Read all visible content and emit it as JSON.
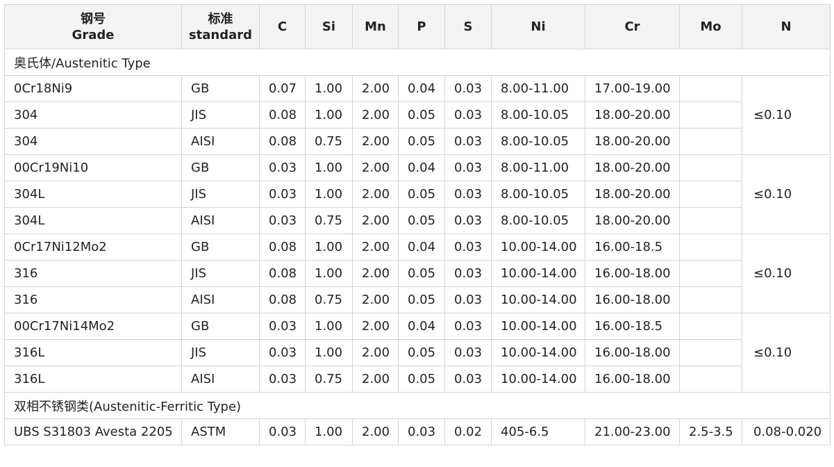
{
  "header": {
    "grade_cn": "钢号",
    "grade_en": "Grade",
    "standard_cn": "标准",
    "standard_en": "standard",
    "elements": [
      "C",
      "Si",
      "Mn",
      "P",
      "S",
      "Ni",
      "Cr",
      "Mo",
      "N"
    ]
  },
  "sections": [
    {
      "title": "奥氏体/Austenitic Type",
      "groups": [
        {
          "n": "≤0.10",
          "rows": [
            {
              "grade": "0Cr18Ni9",
              "std": "GB",
              "c": "0.07",
              "si": "1.00",
              "mn": "2.00",
              "p": "0.04",
              "s": "0.03",
              "ni": "8.00-11.00",
              "cr": "17.00-19.00",
              "mo": ""
            },
            {
              "grade": "304",
              "std": "JIS",
              "c": "0.08",
              "si": "1.00",
              "mn": "2.00",
              "p": "0.05",
              "s": "0.03",
              "ni": "8.00-10.05",
              "cr": "18.00-20.00",
              "mo": ""
            },
            {
              "grade": "304",
              "std": "AISI",
              "c": "0.08",
              "si": "0.75",
              "mn": "2.00",
              "p": "0.05",
              "s": "0.03",
              "ni": "8.00-10.05",
              "cr": "18.00-20.00",
              "mo": ""
            }
          ]
        },
        {
          "n": "≤0.10",
          "rows": [
            {
              "grade": "00Cr19Ni10",
              "std": "GB",
              "c": "0.03",
              "si": "1.00",
              "mn": "2.00",
              "p": "0.04",
              "s": "0.03",
              "ni": "8.00-11.00",
              "cr": "18.00-20.00",
              "mo": ""
            },
            {
              "grade": "304L",
              "std": "JIS",
              "c": "0.03",
              "si": "1.00",
              "mn": "2.00",
              "p": "0.05",
              "s": "0.03",
              "ni": "8.00-10.05",
              "cr": "18.00-20.00",
              "mo": ""
            },
            {
              "grade": "304L",
              "std": "AISI",
              "c": "0.03",
              "si": "0.75",
              "mn": "2.00",
              "p": "0.05",
              "s": "0.03",
              "ni": "8.00-10.05",
              "cr": "18.00-20.00",
              "mo": ""
            }
          ]
        },
        {
          "n": "≤0.10",
          "rows": [
            {
              "grade": "0Cr17Ni12Mo2",
              "std": "GB",
              "c": "0.08",
              "si": "1.00",
              "mn": "2.00",
              "p": "0.04",
              "s": "0.03",
              "ni": "10.00-14.00",
              "cr": "16.00-18.5",
              "mo": ""
            },
            {
              "grade": "316",
              "std": "JIS",
              "c": "0.08",
              "si": "1.00",
              "mn": "2.00",
              "p": "0.05",
              "s": "0.03",
              "ni": "10.00-14.00",
              "cr": "16.00-18.00",
              "mo": ""
            },
            {
              "grade": "316",
              "std": "AISI",
              "c": "0.08",
              "si": "0.75",
              "mn": "2.00",
              "p": "0.05",
              "s": "0.03",
              "ni": "10.00-14.00",
              "cr": "16.00-18.00",
              "mo": ""
            }
          ]
        },
        {
          "n": "≤0.10",
          "rows": [
            {
              "grade": "00Cr17Ni14Mo2",
              "std": "GB",
              "c": "0.03",
              "si": "1.00",
              "mn": "2.00",
              "p": "0.04",
              "s": "0.03",
              "ni": "10.00-14.00",
              "cr": "16.00-18.5",
              "mo": ""
            },
            {
              "grade": "316L",
              "std": "JIS",
              "c": "0.03",
              "si": "1.00",
              "mn": "2.00",
              "p": "0.05",
              "s": "0.03",
              "ni": "10.00-14.00",
              "cr": "16.00-18.00",
              "mo": ""
            },
            {
              "grade": "316L",
              "std": "AISI",
              "c": "0.03",
              "si": "0.75",
              "mn": "2.00",
              "p": "0.05",
              "s": "0.03",
              "ni": "10.00-14.00",
              "cr": "16.00-18.00",
              "mo": ""
            }
          ]
        }
      ]
    },
    {
      "title": "双相不锈钢类(Austenitic-Ferritic Type)",
      "groups": [
        {
          "n": "0.08-0.020",
          "rows": [
            {
              "grade": "UBS S31803 Avesta 2205",
              "std": "ASTM",
              "c": "0.03",
              "si": "1.00",
              "mn": "2.00",
              "p": "0.03",
              "s": "0.02",
              "ni": "405-6.5",
              "cr": "21.00-23.00",
              "mo": "2.5-3.5"
            }
          ]
        }
      ]
    }
  ]
}
